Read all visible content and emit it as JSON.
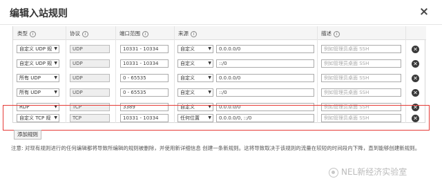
{
  "dialog": {
    "title": "编辑入站规则",
    "close_icon": "×"
  },
  "table": {
    "headers": [
      "类型",
      "协议",
      "端口范围",
      "来源",
      "描述"
    ],
    "info_glyph": "i",
    "rows": [
      {
        "type": "自定义 UDP 规",
        "protocol": "UDP",
        "port": "10331 - 10334",
        "source_type": "自定义",
        "source": "0.0.0.0/0",
        "description": "例如管理员桌面 SSH"
      },
      {
        "type": "自定义 UDP 规",
        "protocol": "UDP",
        "port": "10331 - 10334",
        "source_type": "自定义",
        "source": "::/0",
        "description": "例如管理员桌面 SSH"
      },
      {
        "type": "所有 UDP",
        "protocol": "UDP",
        "port": "0 - 65535",
        "source_type": "自定义",
        "source": "0.0.0.0/0",
        "description": "例如管理员桌面 SSH"
      },
      {
        "type": "所有 UDP",
        "protocol": "UDP",
        "port": "0 - 65535",
        "source_type": "自定义",
        "source": "::/0",
        "description": "例如管理员桌面 SSH"
      },
      {
        "type": "RDP",
        "protocol": "TCP",
        "port": "3389",
        "source_type": "自定义",
        "source": "0.0.0.0/0",
        "description": "例如管理员桌面 SSH"
      },
      {
        "type": "自定义 TCP 规",
        "protocol": "TCP",
        "port": "10331 - 10334",
        "source_type": "任何位置",
        "source": "0.0.0.0/0, ::/0",
        "description": "例如管理员桌面 SSH"
      }
    ]
  },
  "add_rule_label": "添加规则",
  "note": "注意: 对现有规则进行的任何编辑都将导致所编辑的规则被删除，并使用新详细信息 创建一条新规则。这将导致取决于该规则的流量在较短的时间段内下降，直到能够创建新规则。",
  "watermark": "NEL新经济实验室",
  "colors": {
    "highlight": "#e53935",
    "delete_icon": "#3a3a3a"
  }
}
